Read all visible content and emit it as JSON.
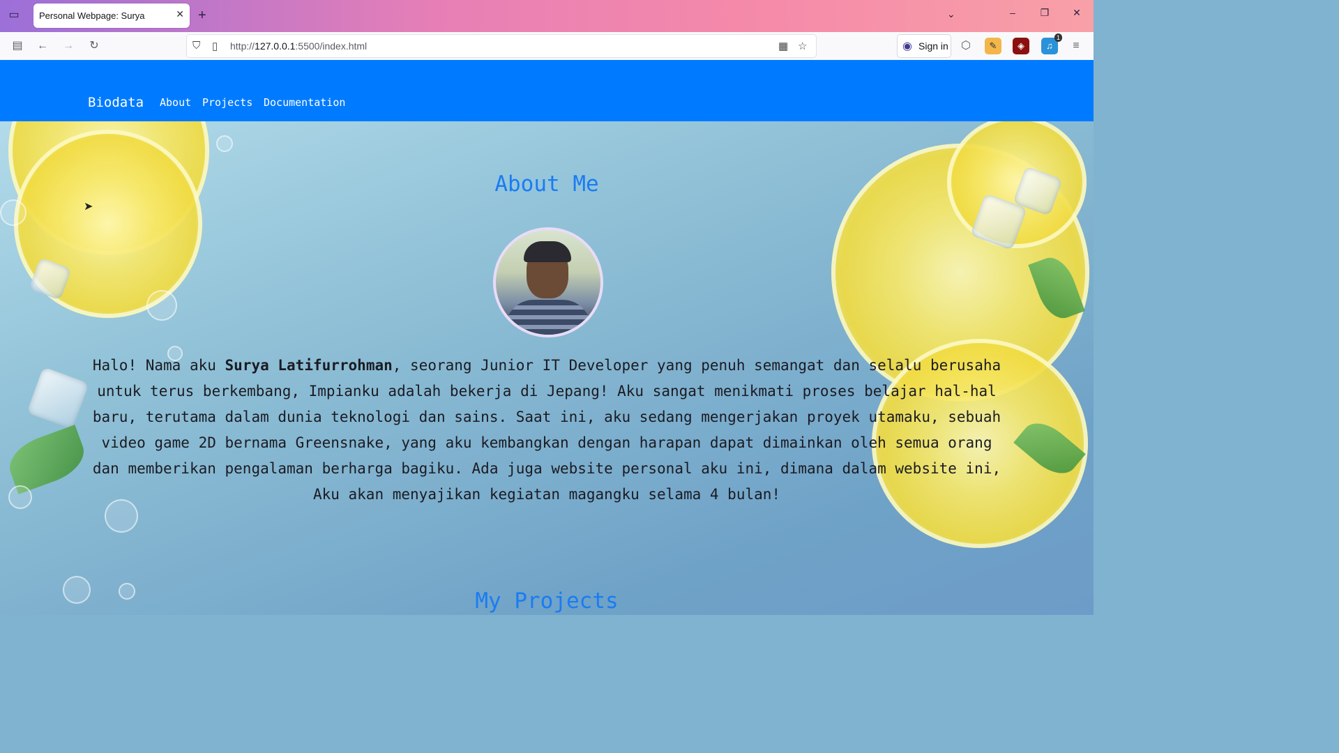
{
  "browser": {
    "tab_title": "Personal Webpage: Surya",
    "url_prefix": "http://",
    "url_host": "127.0.0.1",
    "url_path": ":5500/index.html",
    "signin_label": "Sign in",
    "ext_badge_1": "1"
  },
  "site": {
    "brand": "Biodata",
    "nav": [
      "About",
      "Projects",
      "Documentation"
    ]
  },
  "about": {
    "title": "About Me",
    "bio_intro": "Halo! Nama aku ",
    "bio_name": "Surya Latifurrohman",
    "bio_rest": ", seorang Junior IT Developer yang penuh semangat dan selalu berusaha untuk terus berkembang, Impianku adalah bekerja di Jepang! Aku sangat menikmati proses belajar hal-hal baru, terutama dalam dunia teknologi dan sains. Saat ini, aku sedang mengerjakan proyek utamaku, sebuah video game 2D bernama Greensnake, yang aku kembangkan dengan harapan dapat dimainkan oleh semua orang dan memberikan pengalaman berharga bagiku. Ada juga website personal aku ini, dimana dalam website ini, Aku akan menyajikan kegiatan magangku selama 4 bulan!"
  },
  "projects": {
    "title": "My Projects"
  },
  "colors": {
    "nav_bg": "#007bff",
    "heading": "#1a7cf2"
  }
}
